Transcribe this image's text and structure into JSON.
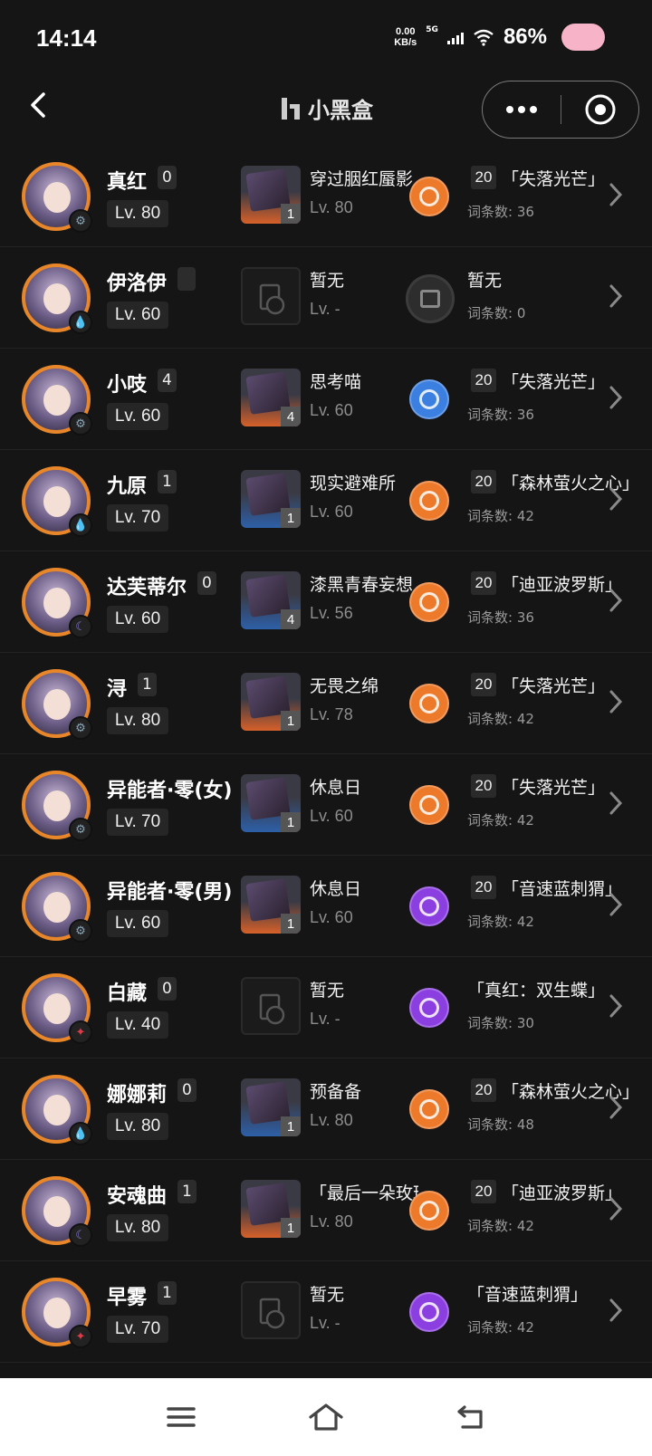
{
  "status": {
    "time": "14:14",
    "speed": "0.00",
    "speed_unit": "KB/s",
    "net": "5G",
    "battery": "86%"
  },
  "header": {
    "title": "小黑盒"
  },
  "colors": {
    "orange": "#e8872a",
    "orange_module": "#ec7a2a",
    "blue_module": "#3b7fe0",
    "purple_module": "#8b3fe0",
    "element_physical": "#8aa6b8",
    "element_ice": "#2aa887",
    "element_ether": "#8b7bd6",
    "element_fire": "#e23a4a"
  },
  "rows": [
    {
      "name": "真红",
      "stars": "0",
      "level": "Lv. 80",
      "element": "gear-icon",
      "weapon": {
        "name": "穿过胭红蜃影",
        "level": "Lv. 80",
        "refine": "1",
        "empty": false,
        "style": "orange"
      },
      "module": {
        "level": "20",
        "name": "「失落光芒」",
        "count": "词条数: 36",
        "color": "orange"
      }
    },
    {
      "name": "伊洛伊",
      "stars": "",
      "level": "Lv. 60",
      "element": "drop-icon",
      "weapon": {
        "name": "暂无",
        "level": "Lv. -",
        "refine": "",
        "empty": true,
        "style": "empty"
      },
      "module": {
        "level": "",
        "name": "暂无",
        "count": "词条数: 0",
        "color": "empty"
      }
    },
    {
      "name": "小吱",
      "stars": "4",
      "level": "Lv. 60",
      "element": "gear-icon",
      "weapon": {
        "name": "思考喵",
        "level": "Lv. 60",
        "refine": "4",
        "empty": false,
        "style": "orange"
      },
      "module": {
        "level": "20",
        "name": "「失落光芒」",
        "count": "词条数: 36",
        "color": "blue"
      }
    },
    {
      "name": "九原",
      "stars": "1",
      "level": "Lv. 70",
      "element": "drop-icon",
      "weapon": {
        "name": "现实避难所",
        "level": "Lv. 60",
        "refine": "1",
        "empty": false,
        "style": "blue"
      },
      "module": {
        "level": "20",
        "name": "「森林萤火之心」",
        "count": "词条数: 42",
        "color": "orange"
      }
    },
    {
      "name": "达芙蒂尔",
      "stars": "0",
      "level": "Lv. 60",
      "element": "moon-icon",
      "weapon": {
        "name": "漆黑青春妄想",
        "level": "Lv. 56",
        "refine": "4",
        "empty": false,
        "style": "blue"
      },
      "module": {
        "level": "20",
        "name": "「迪亚波罗斯」",
        "count": "词条数: 36",
        "color": "orange"
      }
    },
    {
      "name": "浔",
      "stars": "1",
      "level": "Lv. 80",
      "element": "gear-icon",
      "weapon": {
        "name": "无畏之绵",
        "level": "Lv. 78",
        "refine": "1",
        "empty": false,
        "style": "orange"
      },
      "module": {
        "level": "20",
        "name": "「失落光芒」",
        "count": "词条数: 42",
        "color": "orange"
      }
    },
    {
      "name": "异能者·零(女)",
      "stars": "",
      "level": "Lv. 70",
      "element": "gear-icon",
      "weapon": {
        "name": "休息日",
        "level": "Lv. 60",
        "refine": "1",
        "empty": false,
        "style": "blue"
      },
      "module": {
        "level": "20",
        "name": "「失落光芒」",
        "count": "词条数: 42",
        "color": "orange"
      }
    },
    {
      "name": "异能者·零(男)",
      "stars": "",
      "level": "Lv. 60",
      "element": "gear-icon",
      "weapon": {
        "name": "休息日",
        "level": "Lv. 60",
        "refine": "1",
        "empty": false,
        "style": "orange"
      },
      "module": {
        "level": "20",
        "name": "「音速蓝刺猬」",
        "count": "词条数: 42",
        "color": "purple"
      }
    },
    {
      "name": "白藏",
      "stars": "0",
      "level": "Lv. 40",
      "element": "flame-icon",
      "weapon": {
        "name": "暂无",
        "level": "Lv. -",
        "refine": "",
        "empty": true,
        "style": "empty"
      },
      "module": {
        "level": "",
        "name": "「真红：双生蝶」",
        "count": "词条数: 30",
        "color": "purple"
      }
    },
    {
      "name": "娜娜莉",
      "stars": "0",
      "level": "Lv. 80",
      "element": "drop-icon",
      "weapon": {
        "name": "预备备",
        "level": "Lv. 80",
        "refine": "1",
        "empty": false,
        "style": "blue"
      },
      "module": {
        "level": "20",
        "name": "「森林萤火之心」",
        "count": "词条数: 48",
        "color": "orange"
      }
    },
    {
      "name": "安魂曲",
      "stars": "1",
      "level": "Lv. 80",
      "element": "moon-icon",
      "weapon": {
        "name": "「最后一朵玫瑰」",
        "level": "Lv. 80",
        "refine": "1",
        "empty": false,
        "style": "orange"
      },
      "module": {
        "level": "20",
        "name": "「迪亚波罗斯」",
        "count": "词条数: 42",
        "color": "orange"
      }
    },
    {
      "name": "早雾",
      "stars": "1",
      "level": "Lv. 70",
      "element": "flame-icon",
      "weapon": {
        "name": "暂无",
        "level": "Lv. -",
        "refine": "",
        "empty": true,
        "style": "empty"
      },
      "module": {
        "level": "",
        "name": "「音速蓝刺猬」",
        "count": "词条数: 42",
        "color": "purple"
      }
    }
  ]
}
